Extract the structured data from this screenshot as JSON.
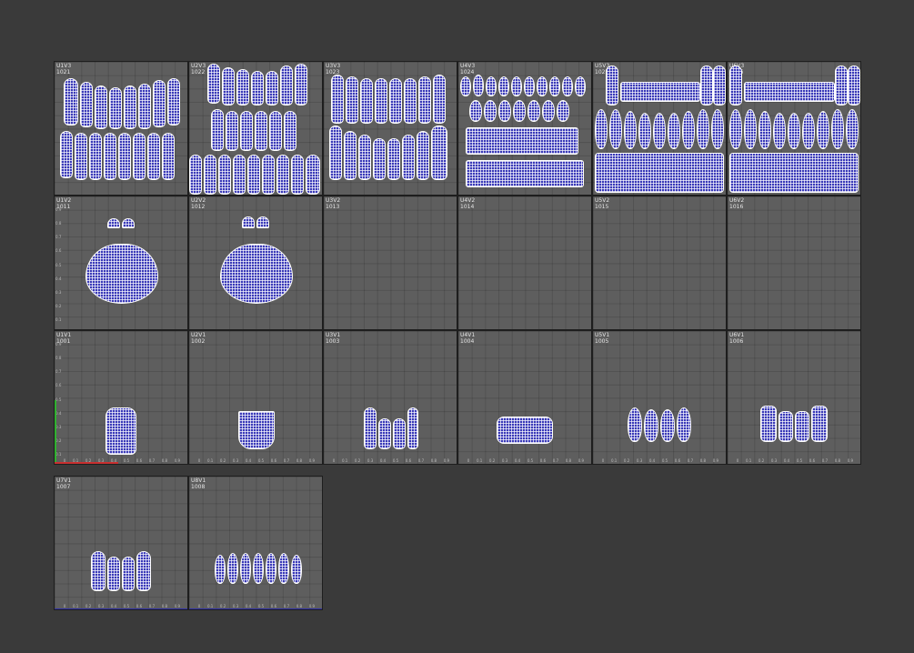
{
  "tiles": [
    {
      "name": "U1V3",
      "udim": "1021"
    },
    {
      "name": "U2V3",
      "udim": "1022"
    },
    {
      "name": "U3V3",
      "udim": "1023"
    },
    {
      "name": "U4V3",
      "udim": "1024"
    },
    {
      "name": "U5V3",
      "udim": "1025"
    },
    {
      "name": "U6V3",
      "udim": "1026"
    },
    {
      "name": "U1V2",
      "udim": "1011"
    },
    {
      "name": "U2V2",
      "udim": "1012"
    },
    {
      "name": "U3V2",
      "udim": "1013"
    },
    {
      "name": "U4V2",
      "udim": "1014"
    },
    {
      "name": "U5V2",
      "udim": "1015"
    },
    {
      "name": "U6V2",
      "udim": "1016"
    },
    {
      "name": "U1V1",
      "udim": "1001"
    },
    {
      "name": "U2V1",
      "udim": "1002"
    },
    {
      "name": "U3V1",
      "udim": "1003"
    },
    {
      "name": "U4V1",
      "udim": "1004"
    },
    {
      "name": "U5V1",
      "udim": "1005"
    },
    {
      "name": "U6V1",
      "udim": "1006"
    },
    {
      "name": "U7V1",
      "udim": "1007"
    },
    {
      "name": "U8V1",
      "udim": "1008"
    }
  ],
  "axis_ticks": [
    "0",
    "0.1",
    "0.2",
    "0.3",
    "0.4",
    "0.5",
    "0.6",
    "0.7",
    "0.8",
    "0.9"
  ],
  "colors": {
    "background": "#3a3a3a",
    "tile": "#5e5e5e",
    "uv_mesh_fill": "#3a3ab8",
    "uv_mesh_wire": "#ffffff",
    "u_axis": "#c83030",
    "v_axis": "#2fb02f"
  }
}
